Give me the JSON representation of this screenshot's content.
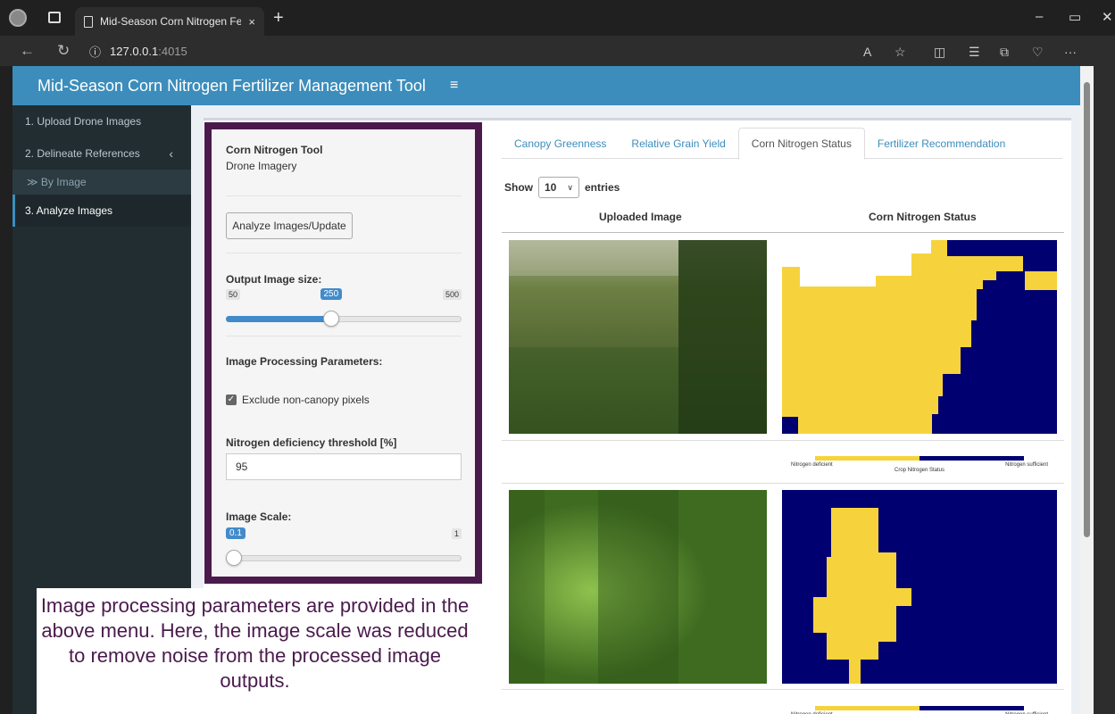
{
  "browser": {
    "tab_title": "Mid-Season Corn Nitrogen Ferti",
    "tab_close": "×",
    "new_tab": "+",
    "url_host": "127.0.0.1",
    "url_port": ":4015",
    "info_icon": "ⓘ"
  },
  "app": {
    "brand": "Mid-Season Corn Nitrogen Fertilizer Management Tool",
    "menu_icon": "≡"
  },
  "sidebar": {
    "items": [
      {
        "label": "1. Upload Drone Images"
      },
      {
        "label": "2. Delineate References",
        "chevron": "‹"
      },
      {
        "label": "≫ By Image"
      },
      {
        "label": "3. Analyze Images"
      }
    ]
  },
  "panel": {
    "title": "Corn Nitrogen Tool",
    "subtitle": "Drone Imagery",
    "analyze_button": "Analyze Images/Update",
    "output_size": {
      "label": "Output Image size:",
      "min": "50",
      "max": "500",
      "value": "250",
      "fraction": 0.444
    },
    "processing_label": "Image Processing Parameters:",
    "exclude_label": "Exclude non-canopy pixels",
    "exclude_checked": true,
    "threshold_label": "Nitrogen deficiency threshold [%]",
    "threshold_value": "95",
    "scale": {
      "label": "Image Scale:",
      "min": "0.1",
      "max": "1",
      "value": "0.1",
      "fraction": 0.0
    }
  },
  "tabs": [
    {
      "label": "Canopy Greenness",
      "active": false
    },
    {
      "label": "Relative Grain Yield",
      "active": false
    },
    {
      "label": "Corn Nitrogen Status",
      "active": true
    },
    {
      "label": "Fertilizer Recommendation",
      "active": false
    }
  ],
  "table": {
    "show_label": "Show",
    "entries_value": "10",
    "entries_label": "entries",
    "col_uploaded": "Uploaded Image",
    "col_status": "Corn Nitrogen Status",
    "legend_left": "Nitrogen deficient",
    "legend_right": "Nitrogen sufficient",
    "legend_center": "Crop Nitrogen Status"
  },
  "colors": {
    "deficient": "#f6d33c",
    "sufficient": "#000070",
    "header": "#3c8dbc",
    "panel_border": "#4a1a4d"
  },
  "caption": {
    "text": "Image processing parameters are provided in the above menu. Here, the image scale was reduced to remove noise from the processed image outputs."
  }
}
